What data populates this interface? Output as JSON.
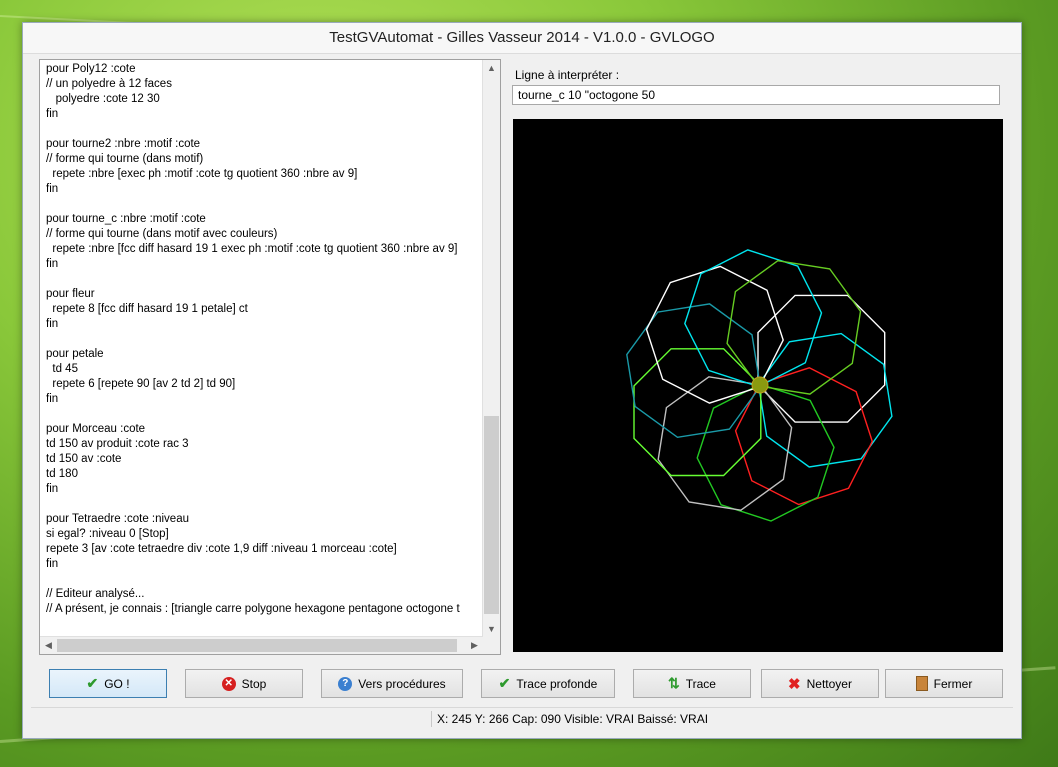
{
  "window": {
    "title": "TestGVAutomat - Gilles Vasseur 2014 - V1.0.0 - GVLOGO"
  },
  "editor": {
    "lines": [
      "pour Poly12 :cote",
      "// un polyedre à 12 faces",
      "   polyedre :cote 12 30",
      "fin",
      "",
      "pour tourne2 :nbre :motif :cote",
      "// forme qui tourne (dans motif)",
      "  repete :nbre [exec ph :motif :cote tg quotient 360 :nbre av 9]",
      "fin",
      "",
      "pour tourne_c :nbre :motif :cote",
      "// forme qui tourne (dans motif avec couleurs)",
      "  repete :nbre [fcc diff hasard 19 1 exec ph :motif :cote tg quotient 360 :nbre av 9]",
      "fin",
      "",
      "pour fleur",
      "  repete 8 [fcc diff hasard 19 1 petale] ct",
      "fin",
      "",
      "pour petale",
      "  td 45",
      "  repete 6 [repete 90 [av 2 td 2] td 90]",
      "fin",
      "",
      "pour Morceau :cote",
      "td 150 av produit :cote rac 3",
      "td 150 av :cote",
      "td 180",
      "fin",
      "",
      "pour Tetraedre :cote :niveau",
      "si egal? :niveau 0 [Stop]",
      "repete 3 [av :cote tetraedre div :cote 1,9 diff :niveau 1 morceau :cote]",
      "fin",
      "",
      "// Editeur analysé...",
      "// A présent, je connais : [triangle carre polygone hexagone pentagone octogone t"
    ]
  },
  "interpreter": {
    "label": "Ligne à interpréter :",
    "value": "tourne_c 10 \"octogone 50"
  },
  "drawing": {
    "command": "tourne_c 10 \"octogone 50",
    "petals": 10,
    "polygon_sides": 8,
    "side_length": 50,
    "advance": 9,
    "colors": [
      "#ffffff",
      "#00e5ee",
      "#ff2020",
      "#22c822",
      "#c0c0c0",
      "#66ff33",
      "#1a9aa8",
      "#ffffff",
      "#00e5ee",
      "#66cc22"
    ],
    "turtle_color": "#8a9a10"
  },
  "buttons": {
    "go": {
      "label": "GO !",
      "icon": "check-icon"
    },
    "stop": {
      "label": "Stop",
      "icon": "stop-icon"
    },
    "procedures": {
      "label": "Vers procédures",
      "icon": "help-icon"
    },
    "deep_trace": {
      "label": "Trace profonde",
      "icon": "double-check-icon"
    },
    "trace": {
      "label": "Trace",
      "icon": "refresh-icon"
    },
    "clean": {
      "label": "Nettoyer",
      "icon": "x-icon"
    },
    "close": {
      "label": "Fermer",
      "icon": "door-icon"
    }
  },
  "status": {
    "text": "X: 245 Y: 266 Cap: 090 Visible: VRAI Baissé: VRAI"
  }
}
